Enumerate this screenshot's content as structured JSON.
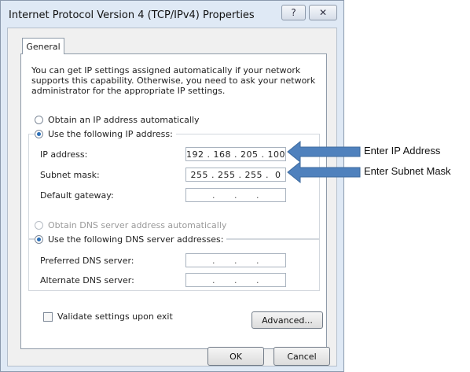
{
  "window": {
    "title": "Internet Protocol Version 4 (TCP/IPv4) Properties",
    "help_glyph": "?",
    "close_glyph": "✕"
  },
  "tabs": {
    "general": "General"
  },
  "intro_text": "You can get IP settings assigned automatically if your network supports this capability. Otherwise, you need to ask your network administrator for the appropriate IP settings.",
  "ip": {
    "auto_label": "Obtain an IP address automatically",
    "manual_label": "Use the following IP address:",
    "selected": "manual",
    "address_label": "IP address:",
    "address_value": "192 . 168 . 205 . 100",
    "subnet_label": "Subnet mask:",
    "subnet_value": "255 . 255 . 255 .  0",
    "gateway_label": "Default gateway:",
    "gateway_value": ".      .      ."
  },
  "dns": {
    "auto_label": "Obtain DNS server address automatically",
    "manual_label": "Use the following DNS server addresses:",
    "selected": "manual",
    "preferred_label": "Preferred DNS server:",
    "preferred_value": ".      .      .",
    "alternate_label": "Alternate DNS server:",
    "alternate_value": ".      .      ."
  },
  "validate_label": "Validate settings upon exit",
  "validate_checked": false,
  "buttons": {
    "advanced": "Advanced...",
    "ok": "OK",
    "cancel": "Cancel"
  },
  "annotations": {
    "ip": "Enter IP Address",
    "subnet": "Enter Subnet Mask",
    "arrow_color": "#4f81bd"
  }
}
